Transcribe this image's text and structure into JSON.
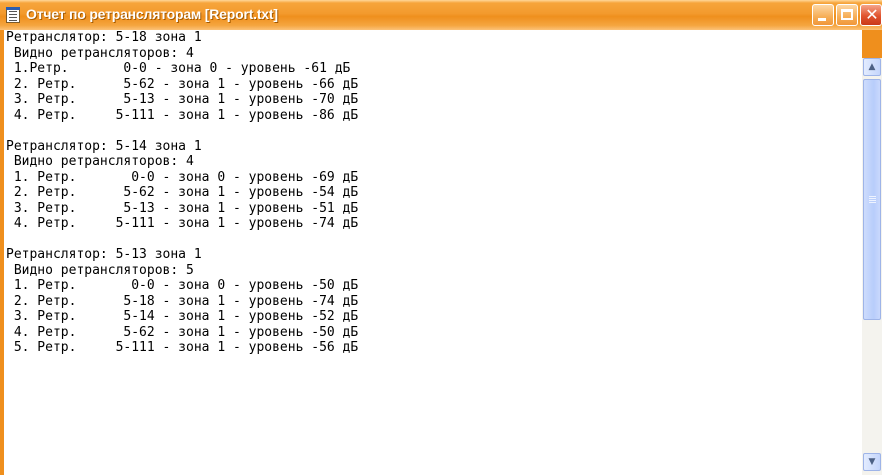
{
  "window": {
    "title": "Отчет по ретрансляторам [Report.txt]"
  },
  "controls": {
    "minimize": "minimize",
    "maximize": "maximize",
    "close_glyph": "✕"
  },
  "report": {
    "lines": [
      "Ретранслятор: 5-18 зона 1",
      " Видно ретрансляторов: 4",
      " 1.Ретр.       0-0 - зона 0 - уровень -61 дБ",
      " 2. Ретр.      5-62 - зона 1 - уровень -66 дБ",
      " 3. Ретр.      5-13 - зона 1 - уровень -70 дБ",
      " 4. Ретр.     5-111 - зона 1 - уровень -86 дБ",
      "",
      "Ретранслятор: 5-14 зона 1",
      " Видно ретрансляторов: 4",
      " 1. Ретр.       0-0 - зона 0 - уровень -69 дБ",
      " 2. Ретр.      5-62 - зона 1 - уровень -54 дБ",
      " 3. Ретр.      5-13 - зона 1 - уровень -51 дБ",
      " 4. Ретр.     5-111 - зона 1 - уровень -74 дБ",
      "",
      "Ретранслятор: 5-13 зона 1",
      " Видно ретрансляторов: 5",
      " 1. Ретр.       0-0 - зона 0 - уровень -50 дБ",
      " 2. Ретр.      5-18 - зона 1 - уровень -74 дБ",
      " 3. Ретр.      5-14 - зона 1 - уровень -52 дБ",
      " 4. Ретр.      5-62 - зона 1 - уровень -50 дБ",
      " 5. Ретр.     5-111 - зона 1 - уровень -56 дБ"
    ]
  },
  "scrollbar": {
    "up_glyph": "▲",
    "down_glyph": "▼"
  },
  "colors": {
    "titlebar": "#f39a2d",
    "scroll_thumb": "#c4d5fb"
  }
}
